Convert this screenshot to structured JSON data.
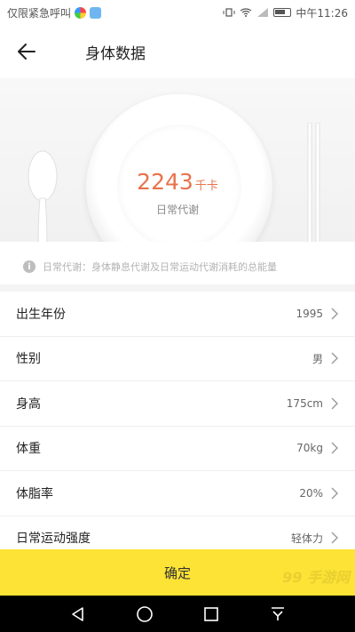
{
  "status_bar": {
    "carrier_text": "仅限紧急呼叫",
    "time": "中午11:26"
  },
  "header": {
    "title": "身体数据",
    "back_icon": "arrow-left-icon"
  },
  "hero": {
    "calorie_value": "2243",
    "calorie_unit": "千卡",
    "calorie_label": "日常代谢"
  },
  "info": {
    "text": "日常代谢：身体静息代谢及日常运动代谢消耗的总能量",
    "icon": "info-icon"
  },
  "rows": [
    {
      "label": "出生年份",
      "value": "1995"
    },
    {
      "label": "性别",
      "value": "男"
    },
    {
      "label": "身高",
      "value": "175cm"
    },
    {
      "label": "体重",
      "value": "70kg"
    },
    {
      "label": "体脂率",
      "value": "20%"
    },
    {
      "label": "日常运动强度",
      "value": "轻体力"
    }
  ],
  "confirm": {
    "label": "确定"
  },
  "watermark": {
    "text": "99 手游网"
  },
  "colors": {
    "accent_yellow": "#fce335",
    "calorie_orange": "#e8734a"
  }
}
